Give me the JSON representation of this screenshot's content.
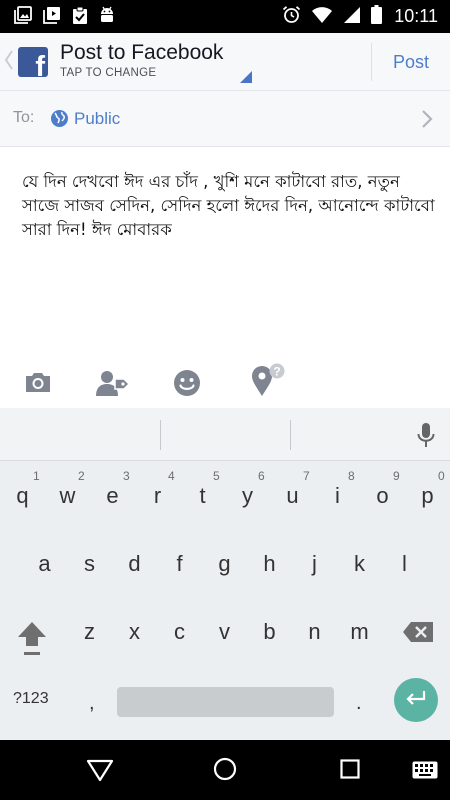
{
  "status_bar": {
    "time": "10:11",
    "left_icons": [
      "gallery-icon",
      "video-icon",
      "clipboard-check-icon",
      "android-icon"
    ],
    "right_icons": [
      "alarm-icon",
      "wifi-icon",
      "signal-icon",
      "battery-icon"
    ]
  },
  "header": {
    "title": "Post to Facebook",
    "subtitle": "TAP TO CHANGE",
    "post_label": "Post",
    "brand_color": "#3b5998",
    "accent_color": "#4f7ec9"
  },
  "audience": {
    "to_label": "To:",
    "value": "Public"
  },
  "composer": {
    "text": "যে দিন দেখবো ঈদ এর চাঁদ , খুশি মনে কাটাবো রাত, নতুন সাজে সাজব সেদিন, সেদিন হলো ঈদের দিন, আনোন্দে কাটাবো সারা দিন! ঈদ মোবারক"
  },
  "attachment_bar": {
    "icons": [
      "camera-icon",
      "tag-people-icon",
      "emoji-icon",
      "location-icon"
    ]
  },
  "keyboard": {
    "row1": [
      "q",
      "w",
      "e",
      "r",
      "t",
      "y",
      "u",
      "i",
      "o",
      "p"
    ],
    "row1_hints": [
      "1",
      "2",
      "3",
      "4",
      "5",
      "6",
      "7",
      "8",
      "9",
      "0"
    ],
    "row2": [
      "a",
      "s",
      "d",
      "f",
      "g",
      "h",
      "j",
      "k",
      "l"
    ],
    "row3": [
      "z",
      "x",
      "c",
      "v",
      "b",
      "n",
      "m"
    ],
    "symbols_label": "?123",
    "comma": ",",
    "period": ".",
    "enter_color": "#5bb3a4"
  },
  "nav_bar": {
    "icons": [
      "back-icon",
      "home-icon",
      "recents-icon",
      "keyboard-switch-icon"
    ]
  }
}
